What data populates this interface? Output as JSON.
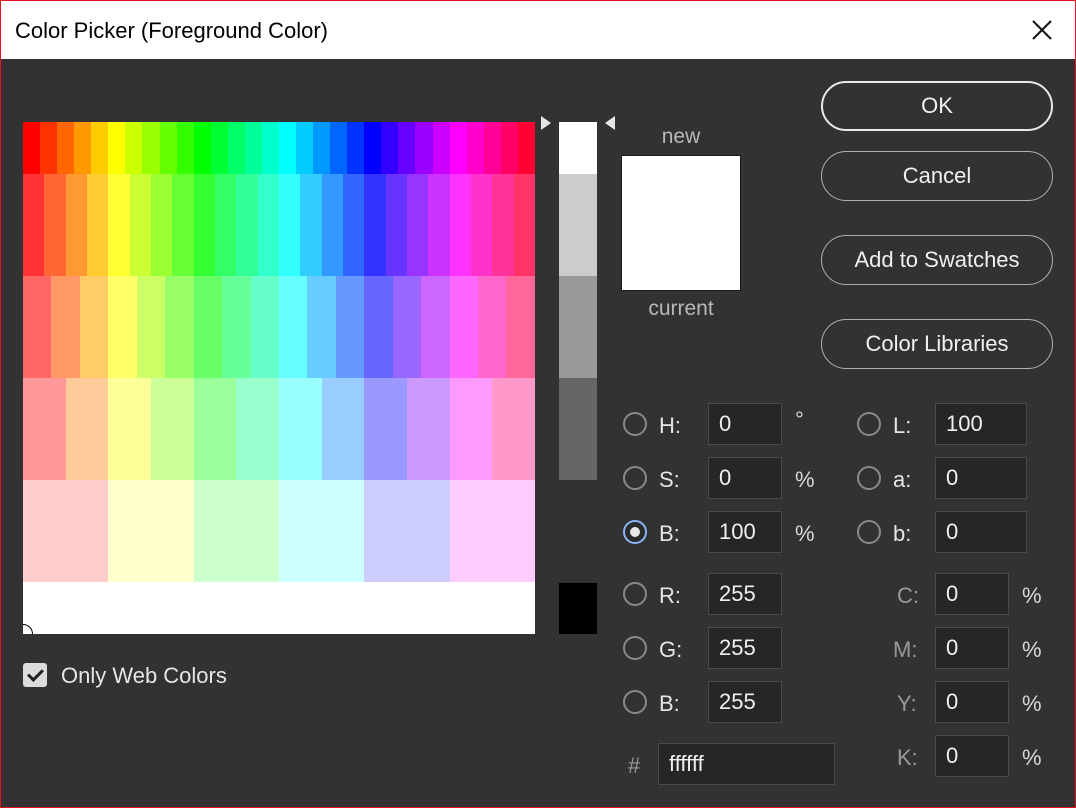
{
  "window": {
    "title": "Color Picker (Foreground Color)"
  },
  "colors": {
    "field_rows": [
      [
        "#ff0000",
        "#ff3300",
        "#ff6600",
        "#ff9900",
        "#ffcc00",
        "#ffff00",
        "#ccff00",
        "#99ff00",
        "#66ff00",
        "#33ff00",
        "#00ff00",
        "#00ff33",
        "#00ff66",
        "#00ff99",
        "#00ffcc",
        "#00ffff",
        "#00ccff",
        "#0099ff",
        "#0066ff",
        "#0033ff",
        "#0000ff",
        "#3300ff",
        "#6600ff",
        "#9900ff",
        "#cc00ff",
        "#ff00ff",
        "#ff00cc",
        "#ff0099",
        "#ff0066",
        "#ff0033"
      ],
      [
        "#ff3333",
        "#ff6633",
        "#ff9933",
        "#ffcc33",
        "#ffff33",
        "#ccff33",
        "#99ff33",
        "#66ff33",
        "#33ff33",
        "#33ff66",
        "#33ff99",
        "#33ffcc",
        "#33ffff",
        "#33ccff",
        "#3399ff",
        "#3366ff",
        "#3333ff",
        "#6633ff",
        "#9933ff",
        "#cc33ff",
        "#ff33ff",
        "#ff33cc",
        "#ff3399",
        "#ff3366"
      ],
      [
        "#ff6666",
        "#ff9966",
        "#ffcc66",
        "#ffff66",
        "#ccff66",
        "#99ff66",
        "#66ff66",
        "#66ff99",
        "#66ffcc",
        "#66ffff",
        "#66ccff",
        "#6699ff",
        "#6666ff",
        "#9966ff",
        "#cc66ff",
        "#ff66ff",
        "#ff66cc",
        "#ff6699"
      ],
      [
        "#ff9999",
        "#ffcc99",
        "#ffff99",
        "#ccff99",
        "#99ff99",
        "#99ffcc",
        "#99ffff",
        "#99ccff",
        "#9999ff",
        "#cc99ff",
        "#ff99ff",
        "#ff99cc"
      ],
      [
        "#ffcccc",
        "#ffffcc",
        "#ccffcc",
        "#ccffff",
        "#ccccff",
        "#ffccff"
      ],
      [
        "#ffffff"
      ]
    ],
    "slider_segments": [
      "#ffffff",
      "#cccccc",
      "#999999",
      "#666666"
    ],
    "new_color": "#ffffff",
    "current_color": "#ffffff"
  },
  "preview": {
    "new_label": "new",
    "current_label": "current"
  },
  "buttons": {
    "ok": "OK",
    "cancel": "Cancel",
    "add_to_swatches": "Add to Swatches",
    "color_libraries": "Color Libraries"
  },
  "fields": {
    "h": {
      "label": "H:",
      "value": "0",
      "unit": "°"
    },
    "s": {
      "label": "S:",
      "value": "0",
      "unit": "%"
    },
    "b": {
      "label": "B:",
      "value": "100",
      "unit": "%"
    },
    "r": {
      "label": "R:",
      "value": "255"
    },
    "g": {
      "label": "G:",
      "value": "255"
    },
    "bl": {
      "label": "B:",
      "value": "255"
    },
    "l": {
      "label": "L:",
      "value": "100"
    },
    "a": {
      "label": "a:",
      "value": "0"
    },
    "lb": {
      "label": "b:",
      "value": "0"
    },
    "c": {
      "label": "C:",
      "value": "0",
      "unit": "%"
    },
    "m": {
      "label": "M:",
      "value": "0",
      "unit": "%"
    },
    "y": {
      "label": "Y:",
      "value": "0",
      "unit": "%"
    },
    "k": {
      "label": "K:",
      "value": "0",
      "unit": "%"
    },
    "hex": {
      "label": "#",
      "value": "ffffff"
    }
  },
  "selected_mode": "B",
  "web_colors": {
    "label": "Only Web Colors",
    "checked": true
  }
}
